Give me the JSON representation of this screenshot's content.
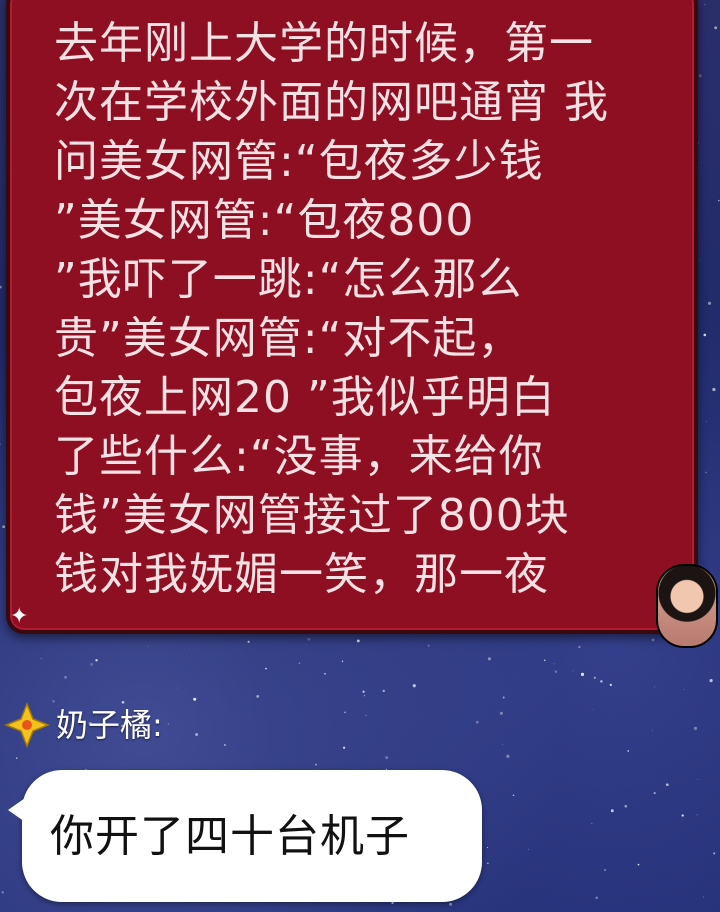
{
  "colors": {
    "background": "#1f2a6b",
    "sent_bubble": "#8e0f22",
    "sent_text": "#f6e1e4",
    "received_bubble": "#ffffff",
    "received_text": "#111111",
    "sender_name": "#ffffff"
  },
  "messages": [
    {
      "direction": "sent",
      "text": "去年刚上大学的时候，第一\n次在学校外面的网吧通宵 我\n问美女网管:“包夜多少钱\n”美女网管:“包夜800\n”我吓了一跳:“怎么那么\n贵”美女网管:“对不起，\n包夜上网20 ”我似乎明白\n了些什么:“没事，来给你\n钱”美女网管接过了800块\n钱对我妩媚一笑，那一夜",
      "avatar_icon": "girl-avatar-icon"
    },
    {
      "direction": "received",
      "sender": "奶子橘:",
      "sender_badge_icon": "gold-star-badge-icon",
      "text": "你开了四十台机子"
    }
  ]
}
